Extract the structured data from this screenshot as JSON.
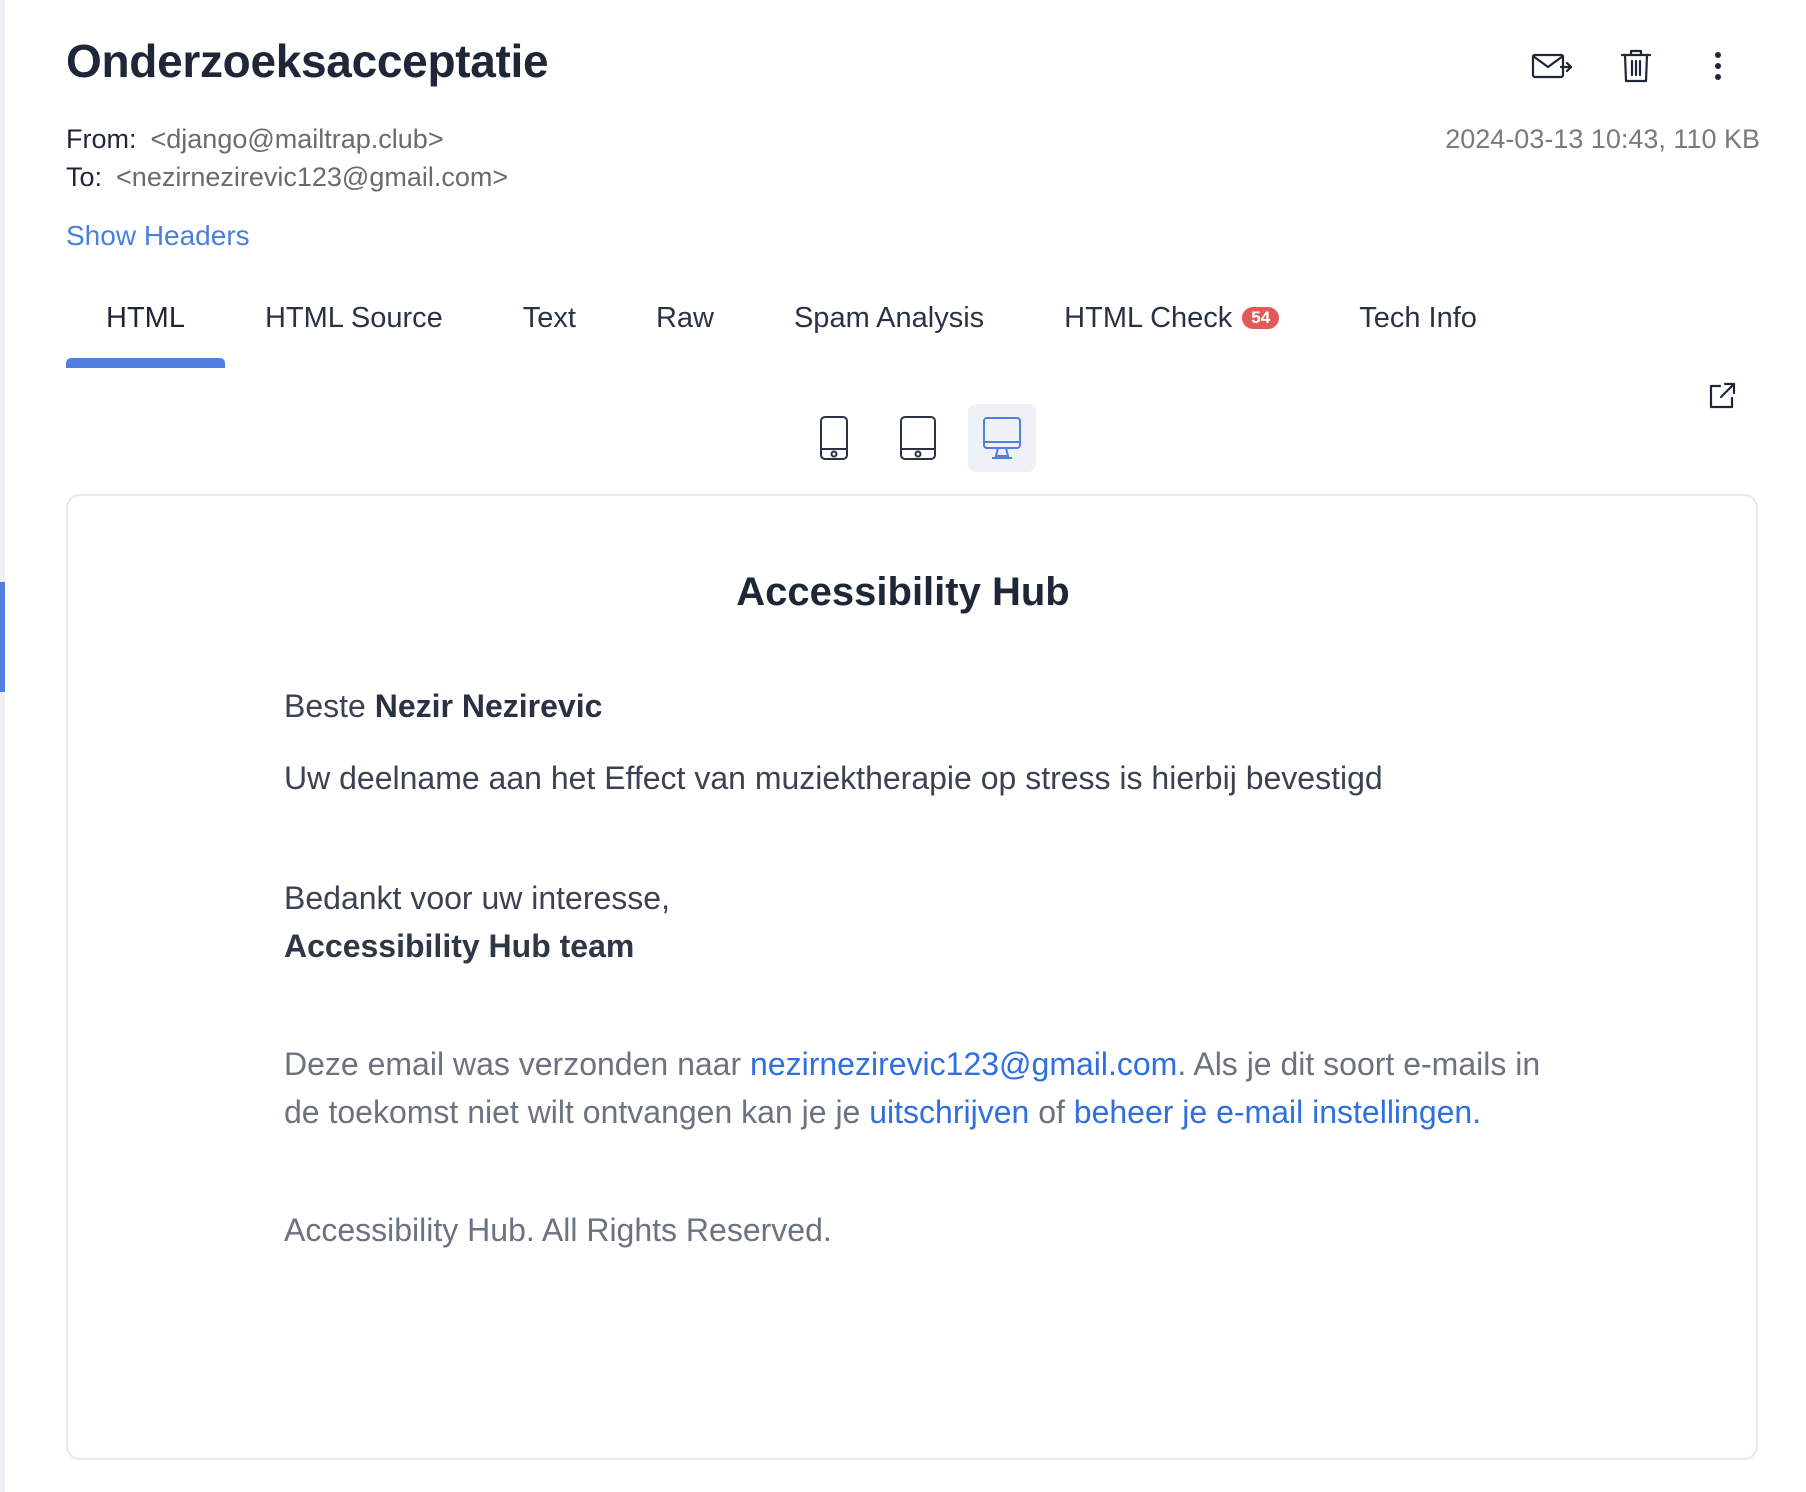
{
  "message": {
    "subject": "Onderzoeksacceptatie",
    "from_label": "From:",
    "from_value": "<django@mailtrap.club>",
    "to_label": "To:",
    "to_value": "<nezirnezirevic123@gmail.com>",
    "date_size": "2024-03-13 10:43, 110 KB",
    "show_headers": "Show Headers"
  },
  "toolbar": {
    "icons": [
      "forward-mail-icon",
      "trash-icon",
      "more-vertical-icon"
    ]
  },
  "tabs": [
    {
      "label": "HTML",
      "active": true
    },
    {
      "label": "HTML Source"
    },
    {
      "label": "Text"
    },
    {
      "label": "Raw"
    },
    {
      "label": "Spam Analysis"
    },
    {
      "label": "HTML Check",
      "badge": "54"
    },
    {
      "label": "Tech Info"
    }
  ],
  "preview": {
    "devices": [
      "mobile-icon",
      "tablet-icon",
      "desktop-icon"
    ],
    "active_device": "desktop",
    "open_icon": "external-link-icon"
  },
  "email": {
    "title": "Accessibility Hub",
    "greeting_prefix": "Beste ",
    "greeting_name": "Nezir Nezirevic",
    "confirmation": "Uw deelname aan het Effect van muziektherapie op stress is hierbij bevestigd",
    "thanks": "Bedankt voor uw interesse,",
    "team": "Accessibility Hub team",
    "footer": {
      "prefix": "Deze email was verzonden naar ",
      "email_link": "nezirnezirevic123@gmail.com",
      "middle": ". Als je dit soort e-mails in de toekomst niet wilt ontvangen kan je je ",
      "unsubscribe_link": "uitschrijven",
      "of": " of ",
      "settings_link": "beheer je e-mail instellingen",
      "end": "."
    },
    "rights": "Accessibility Hub. All Rights Reserved."
  },
  "colors": {
    "accent": "#4f7fe0",
    "link": "#2f6fdf",
    "badge": "#e15a5a"
  }
}
